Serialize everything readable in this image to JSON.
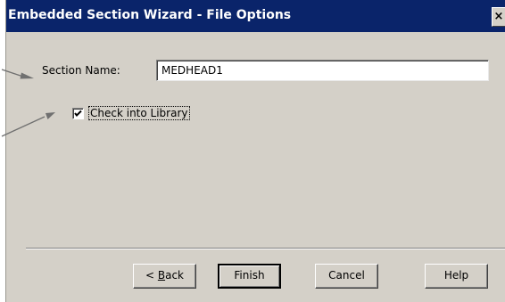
{
  "dialog": {
    "title": "Embedded Section Wizard - File Options",
    "close_glyph": "×"
  },
  "form": {
    "section_name_label": "Section Name:",
    "section_name_value": "MEDHEAD1",
    "check_into_library_label": "Check into Library",
    "check_into_library_checked": true
  },
  "buttons": {
    "back_prefix": "< ",
    "back_accel": "B",
    "back_rest": "ack",
    "finish": "Finish",
    "cancel": "Cancel",
    "help": "Help"
  },
  "colors": {
    "title_bar": "#0a246a",
    "dialog_face": "#d4d0c8",
    "callout_arrow": "#707070"
  }
}
